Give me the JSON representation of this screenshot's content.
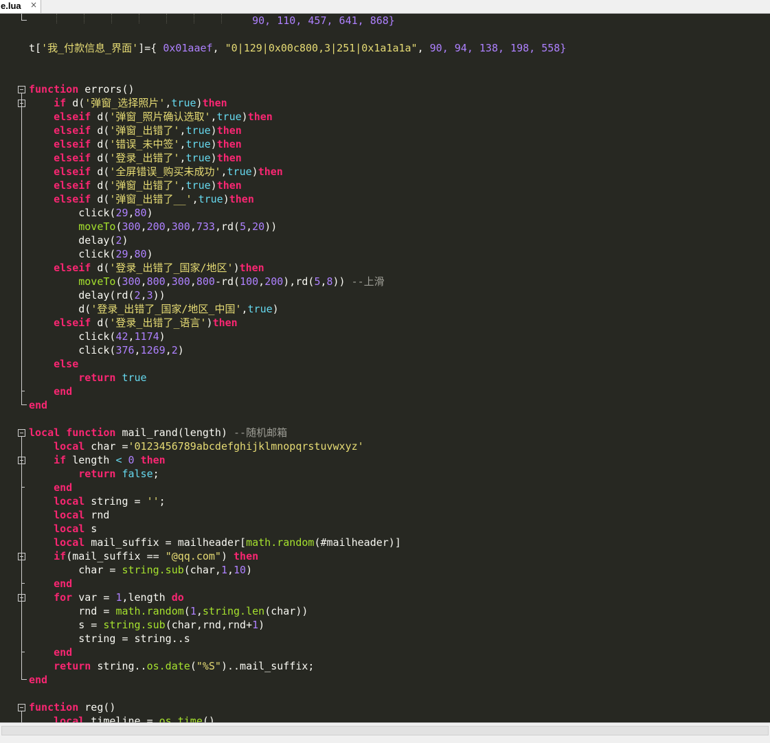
{
  "tab": {
    "filename": "e.lua",
    "close": "×"
  },
  "colors": {
    "background": "#272822",
    "keyword": "#f92672",
    "string": "#e6db74",
    "number": "#ae81ff",
    "function": "#a6e22e",
    "builtin": "#66d9ef",
    "comment": "#9e9e96",
    "default": "#f8f8f2"
  },
  "lines": [
    [
      {
        "t": "                                    ",
        "c": "p"
      },
      {
        "t": "90, 110, 457, 641, 868}",
        "c": "num"
      }
    ],
    [],
    [
      {
        "t": "t[",
        "c": "p"
      },
      {
        "t": "'我_付款信息_界面'",
        "c": "str"
      },
      {
        "t": "]={ ",
        "c": "p"
      },
      {
        "t": "0x01aaef",
        "c": "num"
      },
      {
        "t": ", ",
        "c": "p"
      },
      {
        "t": "\"0|129|0x00c800,3|251|0x1a1a1a\"",
        "c": "str"
      },
      {
        "t": ", ",
        "c": "p"
      },
      {
        "t": "90, 94, 138, 198, 558}",
        "c": "num"
      }
    ],
    [],
    [],
    [
      {
        "t": "function",
        "c": "kw"
      },
      {
        "t": " errors()",
        "c": "p"
      }
    ],
    [
      {
        "t": "    ",
        "c": "p"
      },
      {
        "t": "if",
        "c": "kw"
      },
      {
        "t": " d(",
        "c": "p"
      },
      {
        "t": "'弹窗_选择照片'",
        "c": "str"
      },
      {
        "t": ",",
        "c": "p"
      },
      {
        "t": "true",
        "c": "bi"
      },
      {
        "t": ")",
        "c": "p"
      },
      {
        "t": "then",
        "c": "kw"
      }
    ],
    [
      {
        "t": "    ",
        "c": "p"
      },
      {
        "t": "elseif",
        "c": "kw"
      },
      {
        "t": " d(",
        "c": "p"
      },
      {
        "t": "'弹窗_照片确认选取'",
        "c": "str"
      },
      {
        "t": ",",
        "c": "p"
      },
      {
        "t": "true",
        "c": "bi"
      },
      {
        "t": ")",
        "c": "p"
      },
      {
        "t": "then",
        "c": "kw"
      }
    ],
    [
      {
        "t": "    ",
        "c": "p"
      },
      {
        "t": "elseif",
        "c": "kw"
      },
      {
        "t": " d(",
        "c": "p"
      },
      {
        "t": "'弹窗_出错了'",
        "c": "str"
      },
      {
        "t": ",",
        "c": "p"
      },
      {
        "t": "true",
        "c": "bi"
      },
      {
        "t": ")",
        "c": "p"
      },
      {
        "t": "then",
        "c": "kw"
      }
    ],
    [
      {
        "t": "    ",
        "c": "p"
      },
      {
        "t": "elseif",
        "c": "kw"
      },
      {
        "t": " d(",
        "c": "p"
      },
      {
        "t": "'错误_未中签'",
        "c": "str"
      },
      {
        "t": ",",
        "c": "p"
      },
      {
        "t": "true",
        "c": "bi"
      },
      {
        "t": ")",
        "c": "p"
      },
      {
        "t": "then",
        "c": "kw"
      }
    ],
    [
      {
        "t": "    ",
        "c": "p"
      },
      {
        "t": "elseif",
        "c": "kw"
      },
      {
        "t": " d(",
        "c": "p"
      },
      {
        "t": "'登录_出错了'",
        "c": "str"
      },
      {
        "t": ",",
        "c": "p"
      },
      {
        "t": "true",
        "c": "bi"
      },
      {
        "t": ")",
        "c": "p"
      },
      {
        "t": "then",
        "c": "kw"
      }
    ],
    [
      {
        "t": "    ",
        "c": "p"
      },
      {
        "t": "elseif",
        "c": "kw"
      },
      {
        "t": " d(",
        "c": "p"
      },
      {
        "t": "'全屏错误_购买未成功'",
        "c": "str"
      },
      {
        "t": ",",
        "c": "p"
      },
      {
        "t": "true",
        "c": "bi"
      },
      {
        "t": ")",
        "c": "p"
      },
      {
        "t": "then",
        "c": "kw"
      }
    ],
    [
      {
        "t": "    ",
        "c": "p"
      },
      {
        "t": "elseif",
        "c": "kw"
      },
      {
        "t": " d(",
        "c": "p"
      },
      {
        "t": "'弹窗_出错了'",
        "c": "str"
      },
      {
        "t": ",",
        "c": "p"
      },
      {
        "t": "true",
        "c": "bi"
      },
      {
        "t": ")",
        "c": "p"
      },
      {
        "t": "then",
        "c": "kw"
      }
    ],
    [
      {
        "t": "    ",
        "c": "p"
      },
      {
        "t": "elseif",
        "c": "kw"
      },
      {
        "t": " d(",
        "c": "p"
      },
      {
        "t": "'弹窗_出错了__'",
        "c": "str"
      },
      {
        "t": ",",
        "c": "p"
      },
      {
        "t": "true",
        "c": "bi"
      },
      {
        "t": ")",
        "c": "p"
      },
      {
        "t": "then",
        "c": "kw"
      }
    ],
    [
      {
        "t": "        click(",
        "c": "p"
      },
      {
        "t": "29",
        "c": "num"
      },
      {
        "t": ",",
        "c": "p"
      },
      {
        "t": "80",
        "c": "num"
      },
      {
        "t": ")",
        "c": "p"
      }
    ],
    [
      {
        "t": "        ",
        "c": "p"
      },
      {
        "t": "moveTo",
        "c": "fn"
      },
      {
        "t": "(",
        "c": "p"
      },
      {
        "t": "300",
        "c": "num"
      },
      {
        "t": ",",
        "c": "p"
      },
      {
        "t": "200",
        "c": "num"
      },
      {
        "t": ",",
        "c": "p"
      },
      {
        "t": "300",
        "c": "num"
      },
      {
        "t": ",",
        "c": "p"
      },
      {
        "t": "733",
        "c": "num"
      },
      {
        "t": ",rd(",
        "c": "p"
      },
      {
        "t": "5",
        "c": "num"
      },
      {
        "t": ",",
        "c": "p"
      },
      {
        "t": "20",
        "c": "num"
      },
      {
        "t": "))",
        "c": "p"
      }
    ],
    [
      {
        "t": "        delay(",
        "c": "p"
      },
      {
        "t": "2",
        "c": "num"
      },
      {
        "t": ")",
        "c": "p"
      }
    ],
    [
      {
        "t": "        click(",
        "c": "p"
      },
      {
        "t": "29",
        "c": "num"
      },
      {
        "t": ",",
        "c": "p"
      },
      {
        "t": "80",
        "c": "num"
      },
      {
        "t": ")",
        "c": "p"
      }
    ],
    [
      {
        "t": "    ",
        "c": "p"
      },
      {
        "t": "elseif",
        "c": "kw"
      },
      {
        "t": " d(",
        "c": "p"
      },
      {
        "t": "'登录_出错了_国家/地区'",
        "c": "str"
      },
      {
        "t": ")",
        "c": "p"
      },
      {
        "t": "then",
        "c": "kw"
      }
    ],
    [
      {
        "t": "        ",
        "c": "p"
      },
      {
        "t": "moveTo",
        "c": "fn"
      },
      {
        "t": "(",
        "c": "p"
      },
      {
        "t": "300",
        "c": "num"
      },
      {
        "t": ",",
        "c": "p"
      },
      {
        "t": "800",
        "c": "num"
      },
      {
        "t": ",",
        "c": "p"
      },
      {
        "t": "300",
        "c": "num"
      },
      {
        "t": ",",
        "c": "p"
      },
      {
        "t": "800",
        "c": "num"
      },
      {
        "t": "-rd(",
        "c": "p"
      },
      {
        "t": "100",
        "c": "num"
      },
      {
        "t": ",",
        "c": "p"
      },
      {
        "t": "200",
        "c": "num"
      },
      {
        "t": "),rd(",
        "c": "p"
      },
      {
        "t": "5",
        "c": "num"
      },
      {
        "t": ",",
        "c": "p"
      },
      {
        "t": "8",
        "c": "num"
      },
      {
        "t": ")) ",
        "c": "p"
      },
      {
        "t": "--上滑",
        "c": "cm"
      }
    ],
    [
      {
        "t": "        delay(rd(",
        "c": "p"
      },
      {
        "t": "2",
        "c": "num"
      },
      {
        "t": ",",
        "c": "p"
      },
      {
        "t": "3",
        "c": "num"
      },
      {
        "t": "))",
        "c": "p"
      }
    ],
    [
      {
        "t": "        d(",
        "c": "p"
      },
      {
        "t": "'登录_出错了_国家/地区_中国'",
        "c": "str"
      },
      {
        "t": ",",
        "c": "p"
      },
      {
        "t": "true",
        "c": "bi"
      },
      {
        "t": ")",
        "c": "p"
      }
    ],
    [
      {
        "t": "    ",
        "c": "p"
      },
      {
        "t": "elseif",
        "c": "kw"
      },
      {
        "t": " d(",
        "c": "p"
      },
      {
        "t": "'登录_出错了_语言'",
        "c": "str"
      },
      {
        "t": ")",
        "c": "p"
      },
      {
        "t": "then",
        "c": "kw"
      }
    ],
    [
      {
        "t": "        click(",
        "c": "p"
      },
      {
        "t": "42",
        "c": "num"
      },
      {
        "t": ",",
        "c": "p"
      },
      {
        "t": "1174",
        "c": "num"
      },
      {
        "t": ")",
        "c": "p"
      }
    ],
    [
      {
        "t": "        click(",
        "c": "p"
      },
      {
        "t": "376",
        "c": "num"
      },
      {
        "t": ",",
        "c": "p"
      },
      {
        "t": "1269",
        "c": "num"
      },
      {
        "t": ",",
        "c": "p"
      },
      {
        "t": "2",
        "c": "num"
      },
      {
        "t": ")",
        "c": "p"
      }
    ],
    [
      {
        "t": "    ",
        "c": "p"
      },
      {
        "t": "else",
        "c": "kw"
      }
    ],
    [
      {
        "t": "        ",
        "c": "p"
      },
      {
        "t": "return",
        "c": "kw"
      },
      {
        "t": " ",
        "c": "p"
      },
      {
        "t": "true",
        "c": "bi"
      }
    ],
    [
      {
        "t": "    ",
        "c": "p"
      },
      {
        "t": "end",
        "c": "kw"
      }
    ],
    [
      {
        "t": "end",
        "c": "kw"
      }
    ],
    [],
    [
      {
        "t": "local",
        "c": "kw"
      },
      {
        "t": " ",
        "c": "p"
      },
      {
        "t": "function",
        "c": "kw"
      },
      {
        "t": " mail_rand(length) ",
        "c": "p"
      },
      {
        "t": "--随机邮箱",
        "c": "cm"
      }
    ],
    [
      {
        "t": "    ",
        "c": "p"
      },
      {
        "t": "local",
        "c": "kw"
      },
      {
        "t": " char =",
        "c": "p"
      },
      {
        "t": "'0123456789abcdefghijklmnopqrstuvwxyz'",
        "c": "str"
      }
    ],
    [
      {
        "t": "    ",
        "c": "p"
      },
      {
        "t": "if",
        "c": "kw"
      },
      {
        "t": " length ",
        "c": "p"
      },
      {
        "t": "<",
        "c": "bi"
      },
      {
        "t": " ",
        "c": "p"
      },
      {
        "t": "0",
        "c": "num"
      },
      {
        "t": " ",
        "c": "p"
      },
      {
        "t": "then",
        "c": "kw"
      }
    ],
    [
      {
        "t": "        ",
        "c": "p"
      },
      {
        "t": "return",
        "c": "kw"
      },
      {
        "t": " ",
        "c": "p"
      },
      {
        "t": "false",
        "c": "bi"
      },
      {
        "t": ";",
        "c": "p"
      }
    ],
    [
      {
        "t": "    ",
        "c": "p"
      },
      {
        "t": "end",
        "c": "kw"
      }
    ],
    [
      {
        "t": "    ",
        "c": "p"
      },
      {
        "t": "local",
        "c": "kw"
      },
      {
        "t": " string = ",
        "c": "p"
      },
      {
        "t": "''",
        "c": "str"
      },
      {
        "t": ";",
        "c": "p"
      }
    ],
    [
      {
        "t": "    ",
        "c": "p"
      },
      {
        "t": "local",
        "c": "kw"
      },
      {
        "t": " rnd",
        "c": "p"
      }
    ],
    [
      {
        "t": "    ",
        "c": "p"
      },
      {
        "t": "local",
        "c": "kw"
      },
      {
        "t": " s",
        "c": "p"
      }
    ],
    [
      {
        "t": "    ",
        "c": "p"
      },
      {
        "t": "local",
        "c": "kw"
      },
      {
        "t": " mail_suffix = mailheader[",
        "c": "p"
      },
      {
        "t": "math.random",
        "c": "fn"
      },
      {
        "t": "(#mailheader)]",
        "c": "p"
      }
    ],
    [
      {
        "t": "    ",
        "c": "p"
      },
      {
        "t": "if",
        "c": "kw"
      },
      {
        "t": "(mail_suffix == ",
        "c": "p"
      },
      {
        "t": "\"@qq.com\"",
        "c": "str"
      },
      {
        "t": ") ",
        "c": "p"
      },
      {
        "t": "then",
        "c": "kw"
      }
    ],
    [
      {
        "t": "        char = ",
        "c": "p"
      },
      {
        "t": "string.sub",
        "c": "fn"
      },
      {
        "t": "(char,",
        "c": "p"
      },
      {
        "t": "1",
        "c": "num"
      },
      {
        "t": ",",
        "c": "p"
      },
      {
        "t": "10",
        "c": "num"
      },
      {
        "t": ")",
        "c": "p"
      }
    ],
    [
      {
        "t": "    ",
        "c": "p"
      },
      {
        "t": "end",
        "c": "kw"
      }
    ],
    [
      {
        "t": "    ",
        "c": "p"
      },
      {
        "t": "for",
        "c": "kw"
      },
      {
        "t": " var = ",
        "c": "p"
      },
      {
        "t": "1",
        "c": "num"
      },
      {
        "t": ",length ",
        "c": "p"
      },
      {
        "t": "do",
        "c": "kw"
      }
    ],
    [
      {
        "t": "        rnd = ",
        "c": "p"
      },
      {
        "t": "math.random",
        "c": "fn"
      },
      {
        "t": "(",
        "c": "p"
      },
      {
        "t": "1",
        "c": "num"
      },
      {
        "t": ",",
        "c": "p"
      },
      {
        "t": "string.len",
        "c": "fn"
      },
      {
        "t": "(char))",
        "c": "p"
      }
    ],
    [
      {
        "t": "        s = ",
        "c": "p"
      },
      {
        "t": "string.sub",
        "c": "fn"
      },
      {
        "t": "(char,rnd,rnd+",
        "c": "p"
      },
      {
        "t": "1",
        "c": "num"
      },
      {
        "t": ")",
        "c": "p"
      }
    ],
    [
      {
        "t": "        string = string..s",
        "c": "p"
      }
    ],
    [
      {
        "t": "    ",
        "c": "p"
      },
      {
        "t": "end",
        "c": "kw"
      }
    ],
    [
      {
        "t": "    ",
        "c": "p"
      },
      {
        "t": "return",
        "c": "kw"
      },
      {
        "t": " string..",
        "c": "p"
      },
      {
        "t": "os.date",
        "c": "fn"
      },
      {
        "t": "(",
        "c": "p"
      },
      {
        "t": "\"%S\"",
        "c": "str"
      },
      {
        "t": ")..mail_suffix;",
        "c": "p"
      }
    ],
    [
      {
        "t": "end",
        "c": "kw"
      }
    ],
    [],
    [
      {
        "t": "function",
        "c": "kw"
      },
      {
        "t": " reg()",
        "c": "p"
      }
    ],
    [
      {
        "t": "    ",
        "c": "p"
      },
      {
        "t": "local",
        "c": "kw"
      },
      {
        "t": " timeline = ",
        "c": "p"
      },
      {
        "t": "os.time",
        "c": "fn"
      },
      {
        "t": "()",
        "c": "p"
      }
    ]
  ]
}
